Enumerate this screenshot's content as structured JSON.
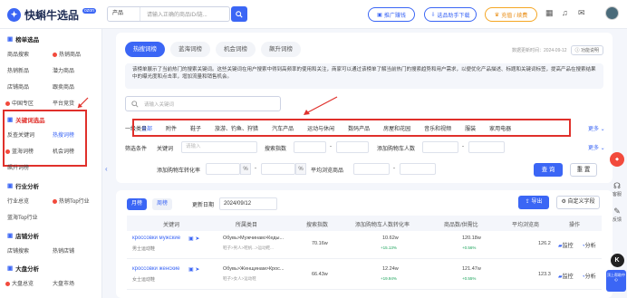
{
  "app": {
    "logo_text": "快蝌牛选品",
    "logo_badge": "ozon"
  },
  "search": {
    "category": "产品",
    "placeholder": "请输入正确的商品ID/链..."
  },
  "top_buttons": {
    "promo": "推广赚钱",
    "downloader": "选品助手下载",
    "recharge": "充值 / 续费"
  },
  "sidebar": {
    "groups": [
      {
        "title": "榜单选品",
        "items": [
          "商品搜索",
          "热销商品",
          "热销新品",
          "潜力商品",
          "店铺商品",
          "跟卖商品",
          "中国专区",
          "平台竞货"
        ]
      },
      {
        "title": "关键词选品",
        "items": [
          "反查关键词",
          "热搜词榜",
          "蓝海词榜",
          "机会词榜",
          "飙升词榜"
        ]
      },
      {
        "title": "行业分析",
        "items": [
          "行业总览",
          "热销Top行业",
          "蓝海Top行业"
        ]
      },
      {
        "title": "店铺分析",
        "items": [
          "店铺搜索",
          "热销店铺"
        ]
      },
      {
        "title": "大盘分析",
        "items": [
          "大盘总览",
          "大盘市场"
        ]
      }
    ]
  },
  "main": {
    "tabs": [
      "热搜词榜",
      "蓝海词榜",
      "机会词榜",
      "飙升词榜"
    ],
    "update_text": "数据更新时间：2024-09-12",
    "update_btn": "功能说明",
    "description": "该榜单展示了当前热门的搜索关键词。这些关键词在用户搜索中得到高频率的使用和关注，商家可以通过该榜单了解当前热门的搜索趋势和用户需求，以便优化产品描述、标题和关键词标签，提高产品在搜索结果中的曝光度和点击率，增加流量和销售机会。",
    "kw_placeholder": "请输入关键词",
    "cat_label": "一级类目",
    "categories": [
      "全部",
      "附件",
      "鞋子",
      "旅游、钓鱼、狩猎",
      "汽车产品",
      "运动与休闲",
      "数码产品",
      "房屋和花园",
      "音乐和视频",
      "服装",
      "家用电器"
    ],
    "more": "更多",
    "filter_label": "筛选条件",
    "keyword_label": "关键词",
    "keyword_ph": "请输入",
    "search_index": "搜索指数",
    "cart_count": "添加购物车人数",
    "cart_conv": "添加购物车转化率",
    "avg_view": "平均浏览商品",
    "pct": "%",
    "dash": "-",
    "query": "查 询",
    "reset": "重 置"
  },
  "panel": {
    "tab_month": "月榜",
    "tab_week": "周榜",
    "date_label": "更新日期",
    "date_value": "2024/09/12",
    "export": "导出",
    "custom": "自定义字段",
    "headers": [
      "关键词",
      "所属类目",
      "搜索指数",
      "添加购物车人数转化率",
      "商品数/供需比",
      "平均浏览商",
      "操作"
    ],
    "rows": [
      {
        "kw": "кроссовки мужские",
        "kw_cn": "男士运动鞋",
        "cat1": "Обувь>Мужчинам>Кеды...",
        "cat2": "鞋子>男人>鞋帆...>运动鞋...",
        "index": "70.16w",
        "cart": "10.62w",
        "cart_rate": "+15.13%",
        "goods": "120.18w",
        "ratio": "+0.56%",
        "avg": "126.2",
        "mon": "监控",
        "ana": "分析"
      },
      {
        "kw": "кроссовки женские",
        "kw_cn": "女士运动鞋",
        "cat1": "Обувь>Женщинам>Крос...",
        "cat2": "鞋子>女人>运动鞋",
        "index": "66.43w",
        "cart": "12.24w",
        "cart_rate": "+19.94%",
        "goods": "121.47w",
        "ratio": "+0.55%",
        "avg": "123.3",
        "mon": "监控",
        "ana": "分析"
      }
    ]
  },
  "right": {
    "service": "客服",
    "feedback": "反馈",
    "top": "顶上帮助中心"
  }
}
